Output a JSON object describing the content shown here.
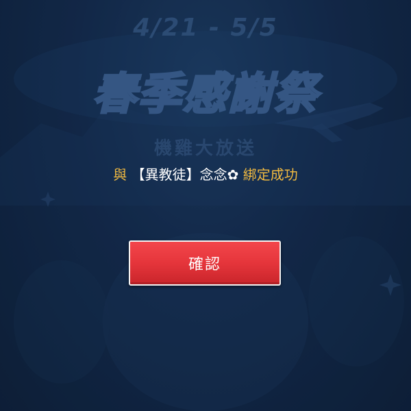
{
  "banner": {
    "dates": "4/21 - 5/5",
    "title": "春季感謝祭",
    "subtitle": "機雞大放送"
  },
  "dialog": {
    "message_prefix": "與",
    "guild_bracket_open": "【",
    "guild_name": "異教徒",
    "guild_bracket_close": "】",
    "character_name": "念念",
    "flower_symbol": "✿",
    "message_suffix": "綁定成功",
    "confirm_label": "確認"
  },
  "colors": {
    "background": "#0f2440",
    "accent_gold": "#f0b940",
    "button_red": "#e5353b",
    "text_white": "#ffffff"
  }
}
